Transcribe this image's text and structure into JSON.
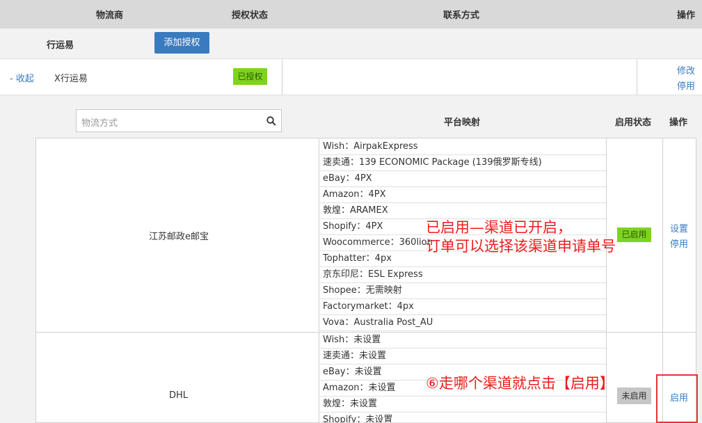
{
  "header": {
    "col_provider": "物流商",
    "col_auth": "授权状态",
    "col_contact": "联系方式",
    "col_action": "操作"
  },
  "provider": {
    "name": "行运易",
    "add_auth_label": "添加授权"
  },
  "account": {
    "collapse_label": "- 收起",
    "name": "X行运易",
    "status": "已授权",
    "edit_label": "修改",
    "disable_label": "停用"
  },
  "channels_table": {
    "search_placeholder": "物流方式",
    "col_mapping": "平台映射",
    "col_status": "启用状态",
    "col_action": "操作",
    "rows": [
      {
        "name": "江苏邮政e邮宝",
        "status": "已启用",
        "action1": "设置",
        "action2": "停用",
        "mappings": [
          "Wish：AirpakExpress",
          "速卖通：139 ECONOMIC Package (139俄罗斯专线)",
          "eBay：4PX",
          "Amazon：4PX",
          "敦煌：ARAMEX",
          "Shopify：4PX",
          "Woocommerce：360lion",
          "Tophatter：4px",
          "京东印尼：ESL Express",
          "Shopee：无需映射",
          "Factorymarket：4px",
          "Vova：Australia Post_AU"
        ]
      },
      {
        "name": "DHL",
        "status": "未启用",
        "action1": "启用",
        "mappings": [
          "Wish：未设置",
          "速卖通：未设置",
          "eBay：未设置",
          "Amazon：未设置",
          "敦煌：未设置",
          "Shopify：未设置"
        ]
      }
    ]
  },
  "annotations": {
    "enabled_line1": "已启用—渠道已开启，",
    "enabled_line2": "订单可以选择该渠道申请单号",
    "step6": "⑥走哪个渠道就点击【启用】"
  },
  "colors": {
    "accent": "#3a7bbf",
    "enabled_badge": "#7ed321",
    "annotation": "#ee1c1c"
  },
  "icons": {
    "search": "search-icon"
  }
}
